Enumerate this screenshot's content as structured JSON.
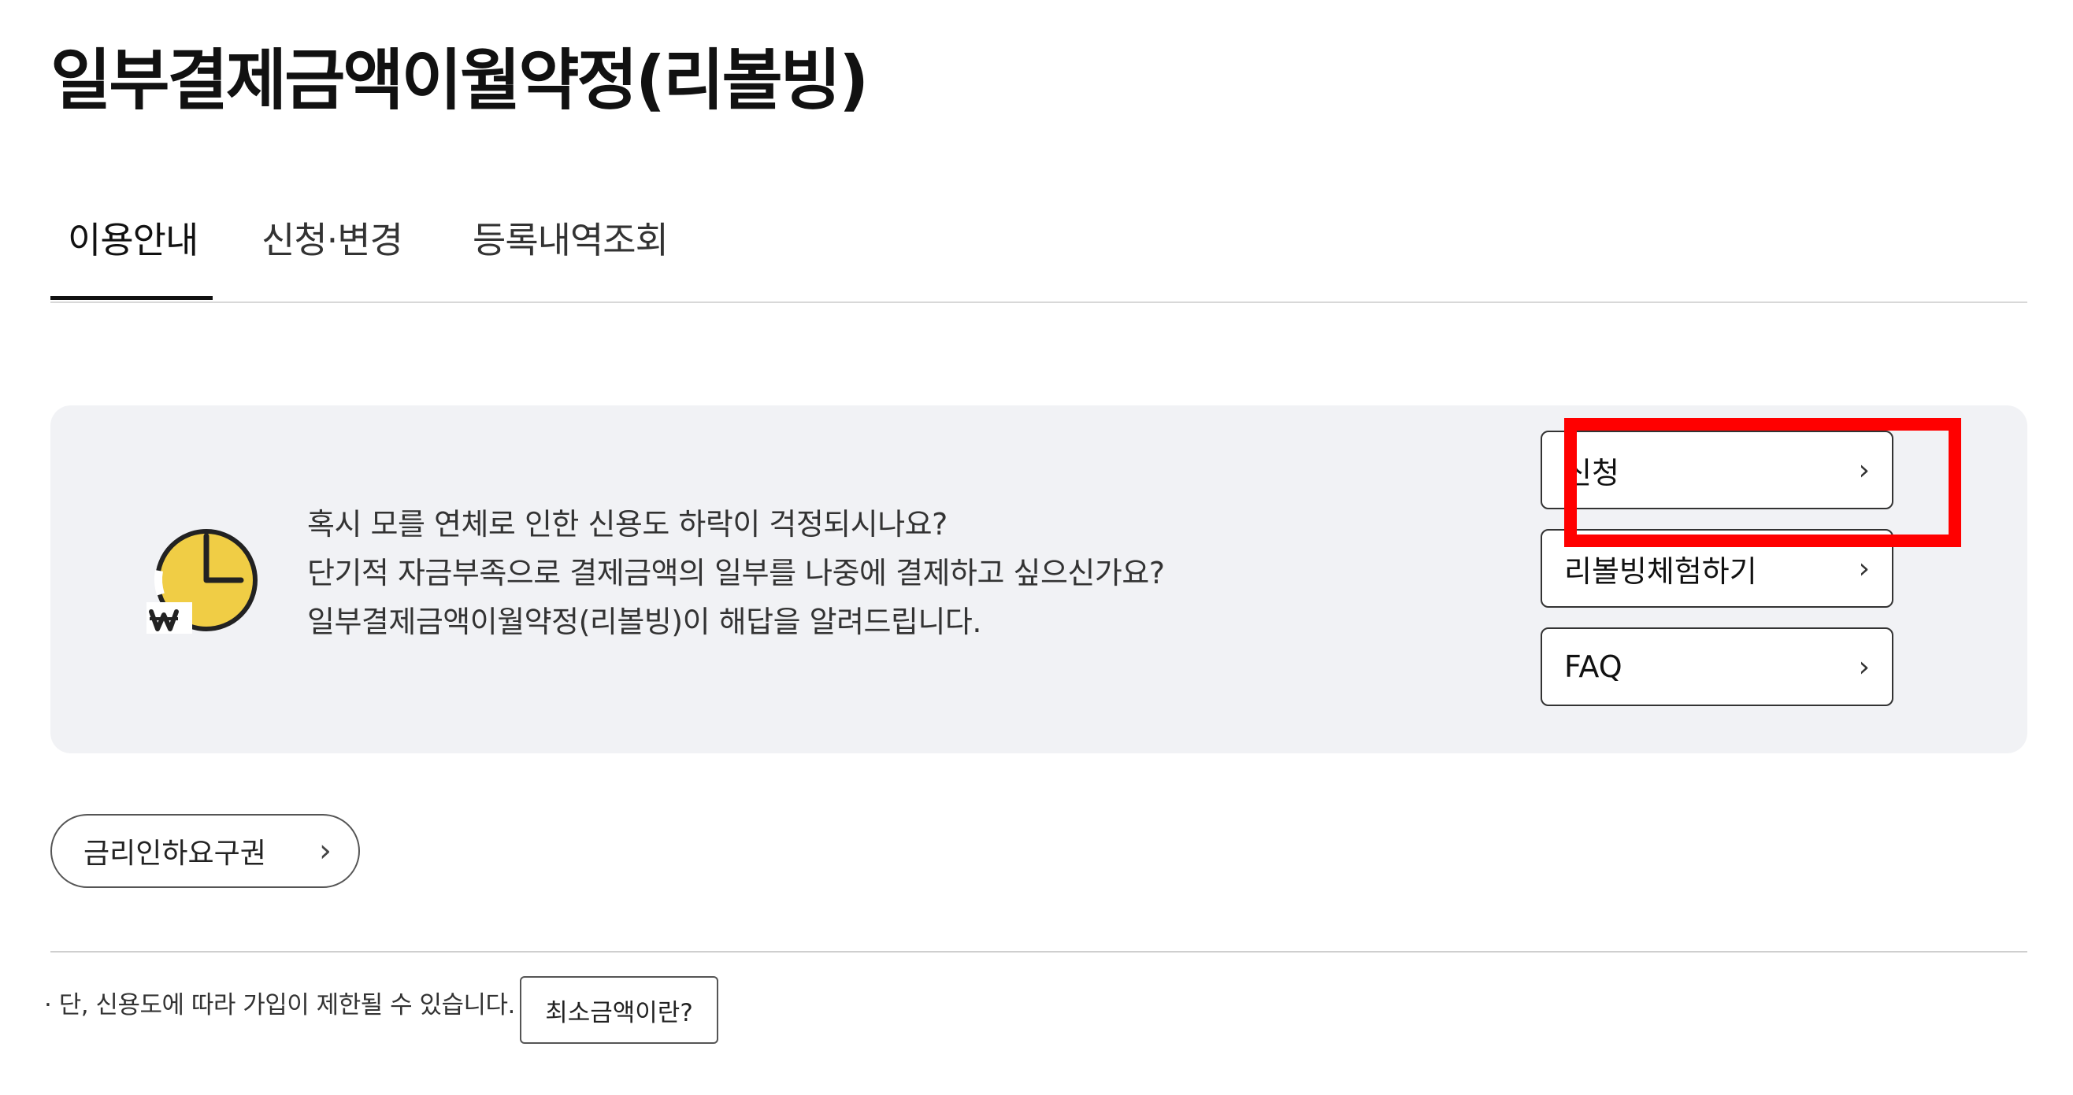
{
  "page": {
    "title": "일부결제금액이월약정(리볼빙)"
  },
  "tabs": [
    {
      "label": "이용안내",
      "active": true
    },
    {
      "label": "신청·변경",
      "active": false
    },
    {
      "label": "등록내역조회",
      "active": false
    }
  ],
  "info": {
    "icon": "clock-won-icon",
    "lines": [
      "혹시 모를 연체로 인한 신용도 하락이 걱정되시나요?",
      "단기적 자금부족으로 결제금액의 일부를 나중에 결제하고 싶으신가요?",
      "일부결제금액이월약정(리볼빙)이 해답을 알려드립니다."
    ],
    "buttons": [
      {
        "label": "신청",
        "icon": "chevron-right-icon"
      },
      {
        "label": "리볼빙체험하기",
        "icon": "chevron-right-icon"
      },
      {
        "label": "FAQ",
        "icon": "chevron-right-icon"
      }
    ]
  },
  "rate_button": {
    "label": "금리인하요구권",
    "icon": "chevron-right-icon"
  },
  "footer": {
    "note": "· 단, 신용도에 따라 가입이 제한될 수 있습니다.",
    "min_amount_button": "최소금액이란?"
  },
  "colors": {
    "highlight": "#ff0000",
    "icon_yellow": "#f0cd45",
    "panel_bg": "#f1f2f5"
  }
}
